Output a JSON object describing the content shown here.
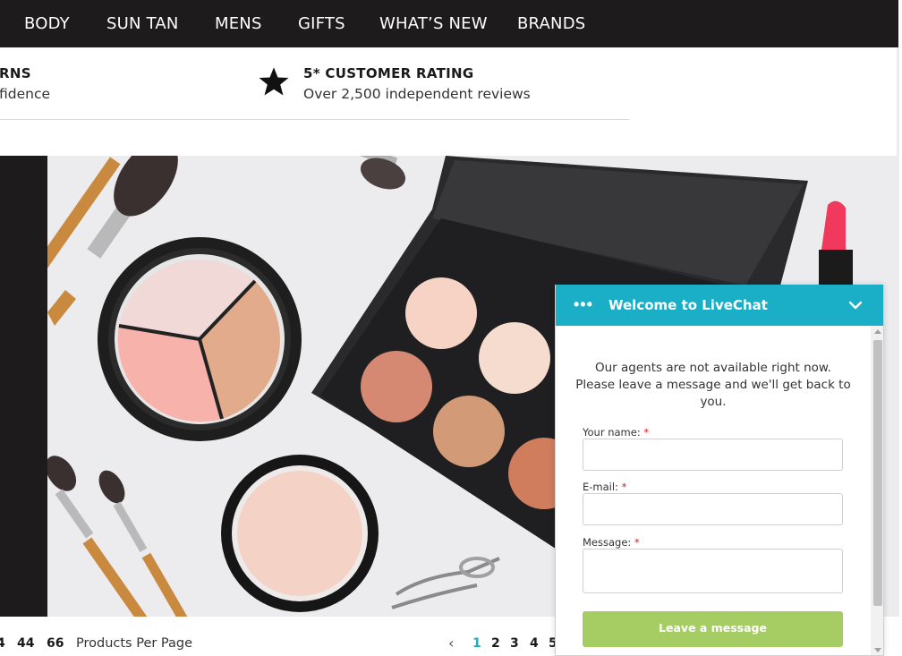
{
  "nav": {
    "items": [
      "BODY",
      "SUN TAN",
      "MENS",
      "GIFTS",
      "WHAT’S NEW",
      "BRANDS"
    ]
  },
  "benefits": {
    "left": {
      "title": "RNS",
      "subtitle": "fidence"
    },
    "rating": {
      "icon": "star-icon",
      "title": "5* CUSTOMER RATING",
      "subtitle": "Over 2,500 independent reviews"
    }
  },
  "hero": {
    "icon": "makeup-products-image"
  },
  "per_page": {
    "options": [
      "4",
      "44",
      "66"
    ],
    "label": "Products Per Page"
  },
  "pagination": {
    "prev": "‹",
    "pages": [
      "1",
      "2",
      "3",
      "4",
      "5"
    ],
    "active": "1"
  },
  "livechat": {
    "menu": "•••",
    "title": "Welcome to LiveChat",
    "message": "Our agents are not available right now. Please leave a message and we'll get back to you.",
    "name_label": "Your name:",
    "email_label": "E-mail:",
    "message_label": "Message:",
    "required_mark": "*",
    "submit_label": "Leave a message",
    "colors": {
      "header": "#1aaec7",
      "submit": "#a6cd63",
      "required": "#d21f1f"
    }
  },
  "colors": {
    "nav_bg": "#1d1b1c",
    "accent": "#2aa8b8"
  }
}
